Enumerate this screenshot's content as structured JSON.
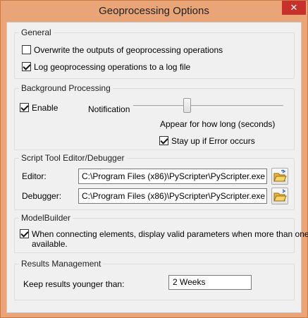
{
  "window": {
    "title": "Geoprocessing Options",
    "close_glyph": "✕"
  },
  "general": {
    "legend": "General",
    "overwrite": {
      "label": "Overwrite the outputs of geoprocessing operations",
      "checked": false
    },
    "log": {
      "label": "Log geoprocessing operations to a log file",
      "checked": true
    }
  },
  "background": {
    "legend": "Background Processing",
    "enable": {
      "label": "Enable",
      "checked": true
    },
    "notification_label": "Notification",
    "slider_caption": "Appear for how long (seconds)",
    "slider_level": 0.35,
    "stay_up": {
      "label": "Stay up if Error occurs",
      "checked": true
    }
  },
  "script_tool": {
    "legend": "Script Tool Editor/Debugger",
    "editor_label": "Editor:",
    "editor_value": "C:\\Program Files (x86)\\PyScripter\\PyScripter.exe",
    "debugger_label": "Debugger:",
    "debugger_value": "C:\\Program Files (x86)\\PyScripter\\PyScripter.exe"
  },
  "modelbuilder": {
    "legend": "ModelBuilder",
    "valid_params": {
      "label_line1": "When connecting elements, display valid parameters when more than one is",
      "label_line2": "available.",
      "checked": true
    }
  },
  "results": {
    "legend": "Results Management",
    "keep_label": "Keep results younger than:",
    "keep_value": "2 Weeks"
  },
  "colors": {
    "title_bar": "#e9a477",
    "close_button": "#c7302b",
    "dialog_face": "#f0f0f0"
  }
}
